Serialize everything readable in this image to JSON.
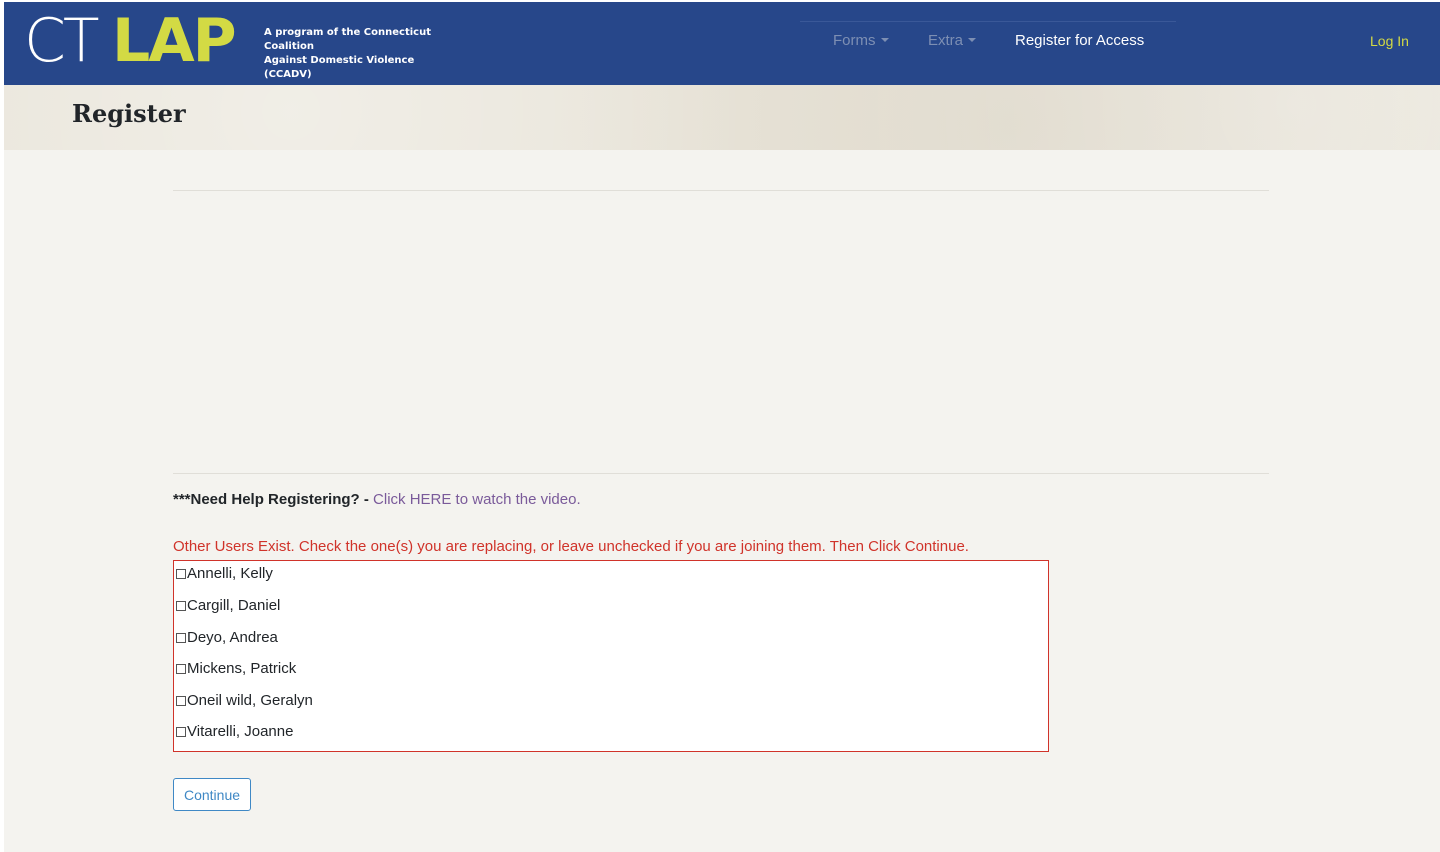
{
  "brand": {
    "logo_ct": "CT",
    "logo_lap": "LAP",
    "tagline_line1": "A program of the Connecticut Coalition",
    "tagline_line2": "Against Domestic Violence (CCADV)"
  },
  "nav": {
    "forms": "Forms",
    "extra": "Extra",
    "register": "Register for Access",
    "login": "Log In"
  },
  "page": {
    "title": "Register"
  },
  "help": {
    "bold": "***Need Help Registering? -",
    "link": "Click HERE to watch the video."
  },
  "warning": "Other Users Exist. Check the one(s) you are replacing, or leave unchecked if you are joining them. Then Click Continue.",
  "users": [
    "Annelli, Kelly",
    "Cargill, Daniel",
    "Deyo, Andrea",
    "Mickens, Patrick",
    "Oneil wild, Geralyn",
    "Vitarelli, Joanne"
  ],
  "continue_label": "Continue",
  "colors": {
    "navbar": "#27478a",
    "logo_accent": "#d3da44",
    "warning": "#d0332a",
    "button": "#3f88c5"
  }
}
